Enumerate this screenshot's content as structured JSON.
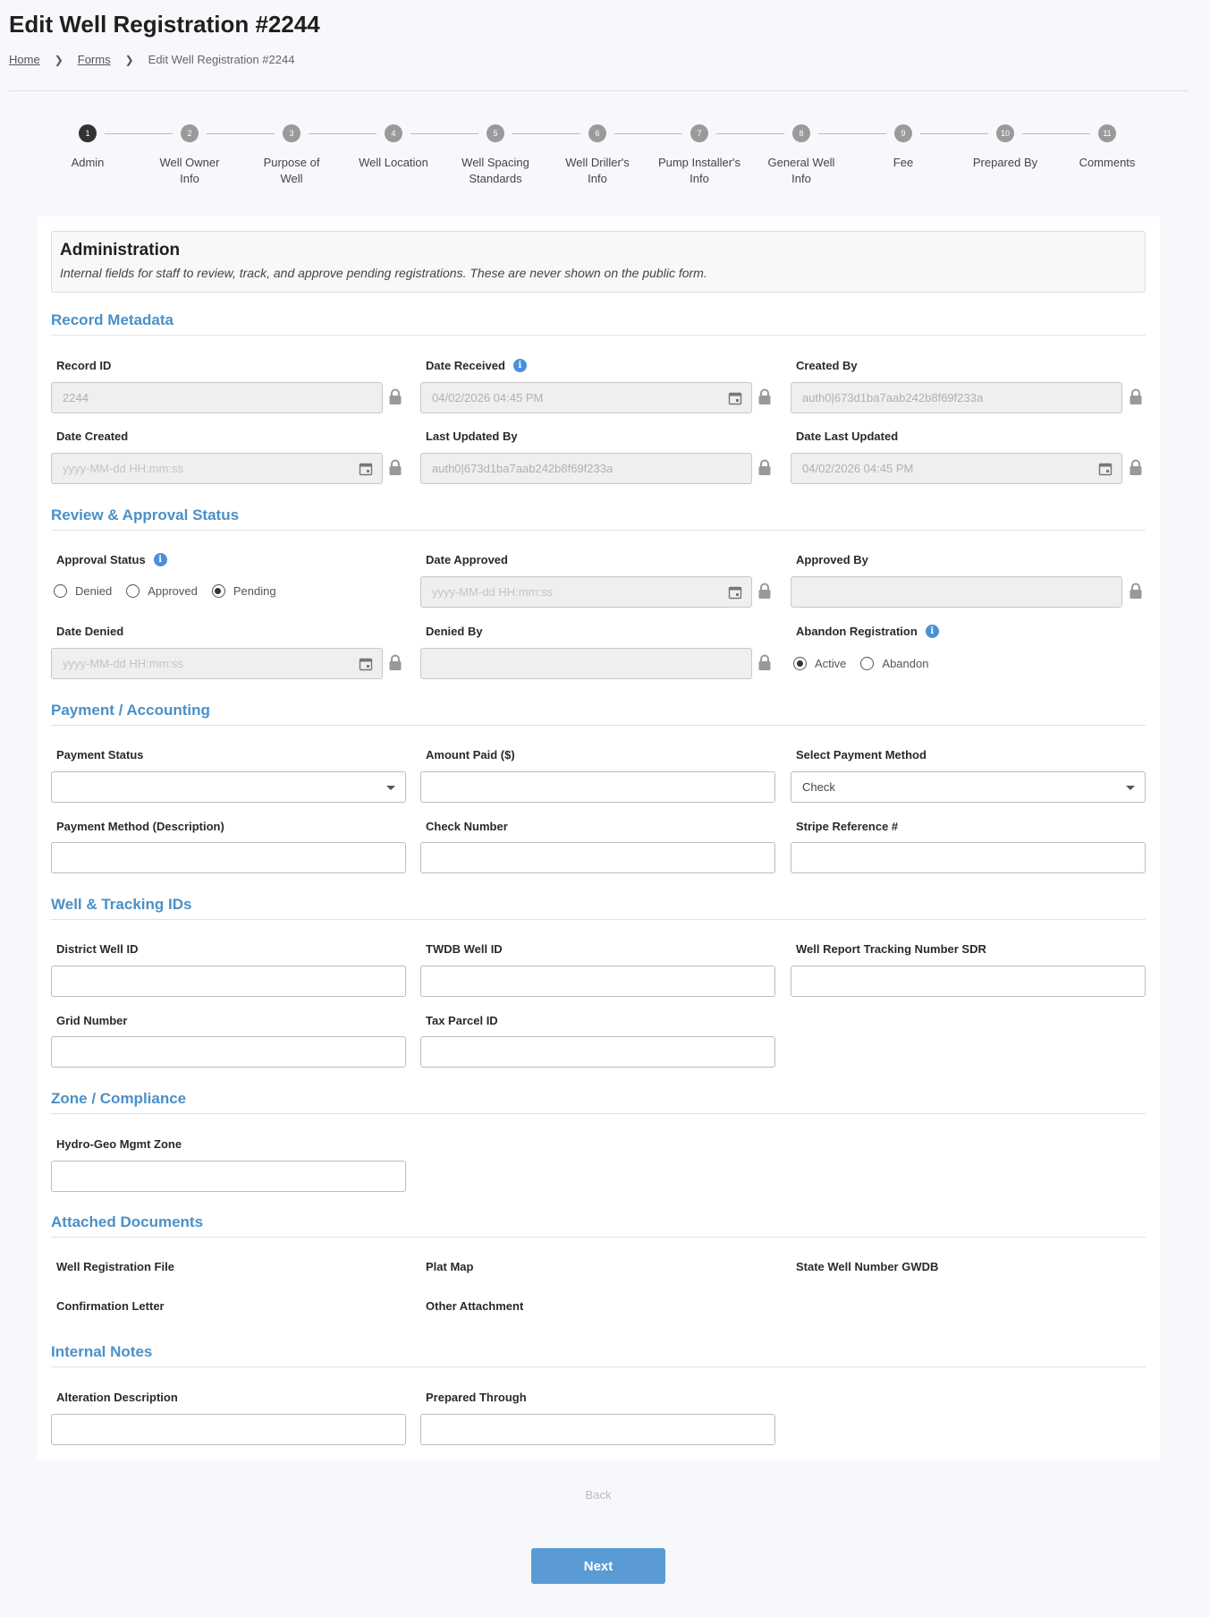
{
  "page": {
    "title": "Edit Well Registration #2244",
    "breadcrumb": [
      "Home",
      "Forms",
      "Edit Well Registration #2244"
    ]
  },
  "steps": [
    {
      "num": "1",
      "label": "Admin"
    },
    {
      "num": "2",
      "label": "Well Owner Info"
    },
    {
      "num": "3",
      "label": "Purpose of Well"
    },
    {
      "num": "4",
      "label": "Well Location"
    },
    {
      "num": "5",
      "label": "Well Spacing Standards"
    },
    {
      "num": "6",
      "label": "Well Driller's Info"
    },
    {
      "num": "7",
      "label": "Pump Installer's Info"
    },
    {
      "num": "8",
      "label": "General Well Info"
    },
    {
      "num": "9",
      "label": "Fee"
    },
    {
      "num": "10",
      "label": "Prepared By"
    },
    {
      "num": "11",
      "label": "Comments"
    }
  ],
  "admin": {
    "heading": "Administration",
    "description": "Internal fields for staff to review, track, and approve pending registrations. These are never shown on the public form."
  },
  "sections": {
    "record_metadata": "Record Metadata",
    "review": "Review & Approval Status",
    "payment": "Payment / Accounting",
    "well_ids": "Well & Tracking IDs",
    "zone": "Zone / Compliance",
    "documents": "Attached Documents",
    "notes": "Internal Notes"
  },
  "fields": {
    "record_id": {
      "label": "Record ID",
      "value": "2244"
    },
    "date_received": {
      "label": "Date Received",
      "value": "04/02/2026 04:45 PM"
    },
    "created_by": {
      "label": "Created By",
      "value": "auth0|673d1ba7aab242b8f69f233a"
    },
    "date_created": {
      "label": "Date Created",
      "placeholder": "yyyy-MM-dd HH:mm:ss"
    },
    "last_updated_by": {
      "label": "Last Updated By",
      "value": "auth0|673d1ba7aab242b8f69f233a"
    },
    "date_last_updated": {
      "label": "Date Last Updated",
      "value": "04/02/2026 04:45 PM"
    },
    "approval_status": {
      "label": "Approval Status",
      "options": [
        "Denied",
        "Approved",
        "Pending"
      ],
      "selected": "Pending"
    },
    "date_approved": {
      "label": "Date Approved",
      "placeholder": "yyyy-MM-dd HH:mm:ss"
    },
    "approved_by": {
      "label": "Approved By"
    },
    "date_denied": {
      "label": "Date Denied",
      "placeholder": "yyyy-MM-dd HH:mm:ss"
    },
    "denied_by": {
      "label": "Denied By"
    },
    "abandon_registration": {
      "label": "Abandon Registration",
      "options": [
        "Active",
        "Abandon"
      ],
      "selected": "Active"
    },
    "payment_status": {
      "label": "Payment Status",
      "value": ""
    },
    "amount_paid": {
      "label": "Amount Paid ($)"
    },
    "payment_method": {
      "label": "Select Payment Method",
      "value": "Check"
    },
    "payment_method_desc": {
      "label": "Payment Method (Description)"
    },
    "check_number": {
      "label": "Check Number"
    },
    "stripe_ref": {
      "label": "Stripe Reference #"
    },
    "district_well_id": {
      "label": "District Well ID"
    },
    "twdb_well_id": {
      "label": "TWDB Well ID"
    },
    "well_report_tracking": {
      "label": "Well Report Tracking Number SDR"
    },
    "grid_number": {
      "label": "Grid Number"
    },
    "tax_parcel_id": {
      "label": "Tax Parcel ID"
    },
    "hydro_geo_zone": {
      "label": "Hydro-Geo Mgmt Zone"
    },
    "well_registration_file": {
      "label": "Well Registration File"
    },
    "plat_map": {
      "label": "Plat Map"
    },
    "state_well_number": {
      "label": "State Well Number GWDB"
    },
    "confirmation_letter": {
      "label": "Confirmation Letter"
    },
    "other_attachment": {
      "label": "Other Attachment"
    },
    "alteration_description": {
      "label": "Alteration Description"
    },
    "prepared_through": {
      "label": "Prepared Through"
    }
  },
  "buttons": {
    "back": "Back",
    "next": "Next"
  },
  "colors": {
    "accent": "#4a90c8",
    "next_button": "#5b9bd5",
    "active_step": "#333333"
  }
}
